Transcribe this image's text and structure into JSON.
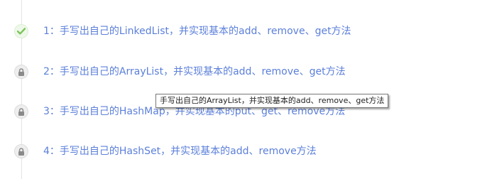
{
  "lessons": [
    {
      "title": "1：手写出自己的LinkedList，并实现基本的add、remove、get方法",
      "status": "completed",
      "icon": "check-icon"
    },
    {
      "title": "2：手写出自己的ArrayList，并实现基本的add、remove、get方法",
      "status": "locked",
      "icon": "lock-icon"
    },
    {
      "title": "3：手写出自己的HashMap，并实现基本的put、get、remove方法",
      "status": "locked",
      "icon": "lock-icon"
    },
    {
      "title": "4：手写出自己的HashSet，并实现基本的add、remove方法",
      "status": "locked",
      "icon": "lock-icon"
    }
  ],
  "tooltip": {
    "text": "手写出自己的ArrayList，并实现基本的add、remove、get方法"
  },
  "colors": {
    "link": "#5b7fd9",
    "check": "#7cc35a",
    "lock": "#8a8a8a",
    "line": "#e2e2e2"
  }
}
